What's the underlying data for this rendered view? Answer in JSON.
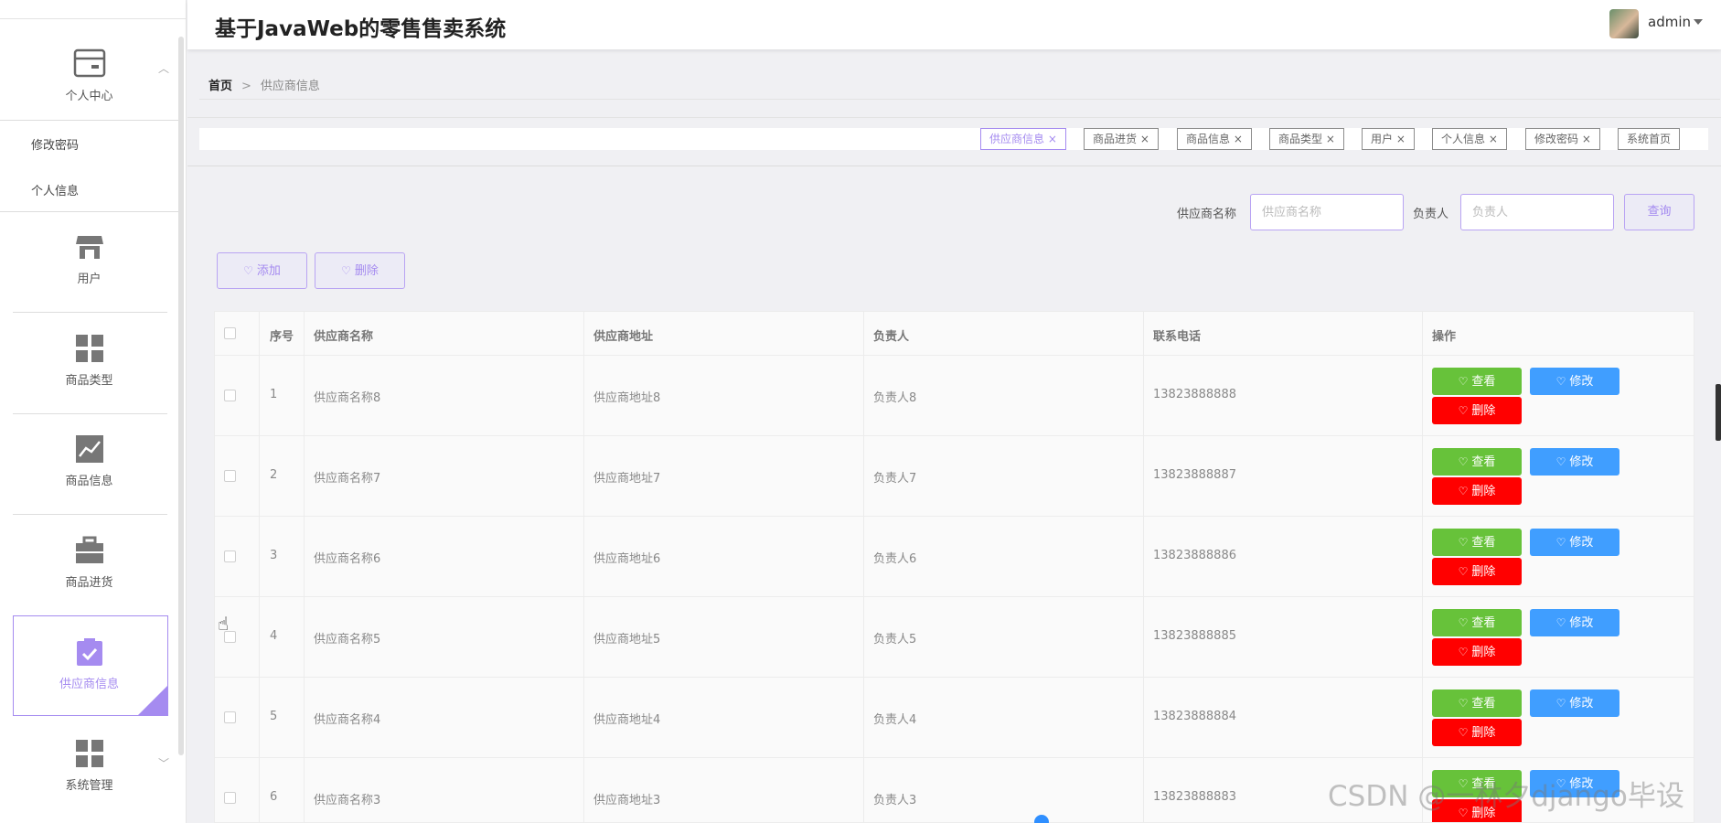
{
  "header": {
    "title": "基于JavaWeb的零售售卖系统",
    "user": "admin"
  },
  "sidebar": {
    "personal": {
      "label": "个人中心",
      "subs": [
        "修改密码",
        "个人信息"
      ]
    },
    "items": [
      {
        "label": "用户",
        "icon": "store-icon"
      },
      {
        "label": "商品类型",
        "icon": "grid-icon"
      },
      {
        "label": "商品信息",
        "icon": "chart-icon"
      },
      {
        "label": "商品进货",
        "icon": "briefcase-icon"
      },
      {
        "label": "供应商信息",
        "icon": "clipboard-check-icon",
        "active": true
      },
      {
        "label": "系统管理",
        "icon": "grid-icon"
      }
    ]
  },
  "breadcrumb": {
    "home": "首页",
    "sep": ">",
    "current": "供应商信息"
  },
  "tags": [
    "供应商信息",
    "商品进货",
    "商品信息",
    "商品类型",
    "用户",
    "个人信息",
    "修改密码",
    "系统首页"
  ],
  "search": {
    "name_label": "供应商名称",
    "name_placeholder": "供应商名称",
    "owner_label": "负责人",
    "owner_placeholder": "负责人",
    "button": "查询"
  },
  "actions": {
    "add": "添加",
    "delete": "删除"
  },
  "table": {
    "columns": [
      "序号",
      "供应商名称",
      "供应商地址",
      "负责人",
      "联系电话",
      "操作"
    ],
    "rows": [
      {
        "no": "1",
        "name": "供应商名称8",
        "addr": "供应商地址8",
        "owner": "负责人8",
        "phone": "13823888888"
      },
      {
        "no": "2",
        "name": "供应商名称7",
        "addr": "供应商地址7",
        "owner": "负责人7",
        "phone": "13823888887"
      },
      {
        "no": "3",
        "name": "供应商名称6",
        "addr": "供应商地址6",
        "owner": "负责人6",
        "phone": "13823888886"
      },
      {
        "no": "4",
        "name": "供应商名称5",
        "addr": "供应商地址5",
        "owner": "负责人5",
        "phone": "13823888885"
      },
      {
        "no": "5",
        "name": "供应商名称4",
        "addr": "供应商地址4",
        "owner": "负责人4",
        "phone": "13823888884"
      },
      {
        "no": "6",
        "name": "供应商名称3",
        "addr": "供应商地址3",
        "owner": "负责人3",
        "phone": "13823888883"
      }
    ],
    "buttons": {
      "view": "查看",
      "edit": "修改",
      "delete": "删除"
    }
  },
  "watermark": "CSDN @一林夕django毕设",
  "colors": {
    "accent": "#a58bf0",
    "view": "#67c23a",
    "edit": "#409eff",
    "delete": "#ff0000"
  }
}
